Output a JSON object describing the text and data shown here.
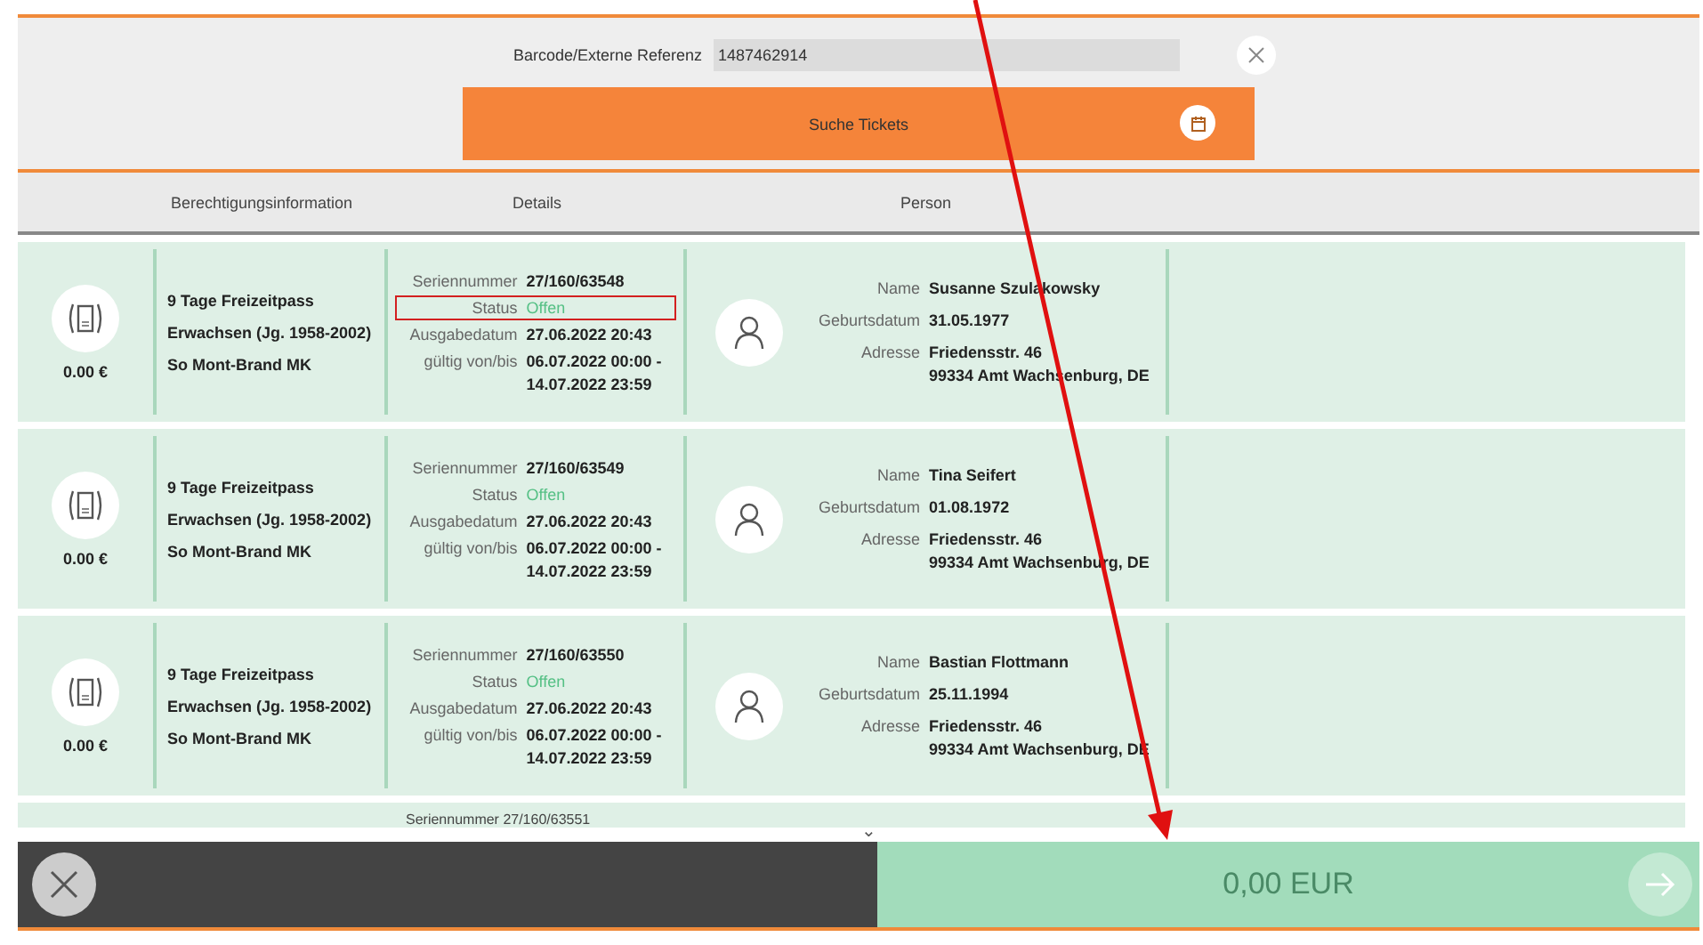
{
  "search": {
    "label": "Barcode/Externe Referenz",
    "value": "1487462914",
    "button": "Suche Tickets"
  },
  "columns": [
    "Berechtigungsinformation",
    "Details",
    "Person"
  ],
  "tickets": [
    {
      "price": "0.00 €",
      "product": "9 Tage Freizeitpass",
      "category": "Erwachsen (Jg. 1958-2002)",
      "area": "So Mont-Brand MK",
      "serial_label": "Seriennummer",
      "serial": "27/160/63548",
      "status_label": "Status",
      "status": "Offen",
      "status_marked": true,
      "issued_label": "Ausgabedatum",
      "issued": "27.06.2022 20:43",
      "valid_label": "gültig von/bis",
      "valid_from": "06.07.2022 00:00 -",
      "valid_to": "14.07.2022 23:59",
      "name_label": "Name",
      "name": "Susanne Szulakowsky",
      "birth_label": "Geburtsdatum",
      "birth": "31.05.1977",
      "address_label": "Adresse",
      "address": [
        "Friedensstr. 46",
        "99334 Amt Wachsenburg, DE"
      ]
    },
    {
      "price": "0.00 €",
      "product": "9 Tage Freizeitpass",
      "category": "Erwachsen (Jg. 1958-2002)",
      "area": "So Mont-Brand MK",
      "serial_label": "Seriennummer",
      "serial": "27/160/63549",
      "status_label": "Status",
      "status": "Offen",
      "status_marked": false,
      "issued_label": "Ausgabedatum",
      "issued": "27.06.2022 20:43",
      "valid_label": "gültig von/bis",
      "valid_from": "06.07.2022 00:00 -",
      "valid_to": "14.07.2022 23:59",
      "name_label": "Name",
      "name": "Tina  Seifert",
      "birth_label": "Geburtsdatum",
      "birth": "01.08.1972",
      "address_label": "Adresse",
      "address": [
        "Friedensstr. 46",
        "99334 Amt Wachsenburg, DE"
      ]
    },
    {
      "price": "0.00 €",
      "product": "9 Tage Freizeitpass",
      "category": "Erwachsen (Jg. 1958-2002)",
      "area": "So Mont-Brand MK",
      "serial_label": "Seriennummer",
      "serial": "27/160/63550",
      "status_label": "Status",
      "status": "Offen",
      "status_marked": false,
      "issued_label": "Ausgabedatum",
      "issued": "27.06.2022 20:43",
      "valid_label": "gültig von/bis",
      "valid_from": "06.07.2022 00:00 -",
      "valid_to": "14.07.2022 23:59",
      "name_label": "Name",
      "name": "Bastian  Flottmann",
      "birth_label": "Geburtsdatum",
      "birth": "25.11.1994",
      "address_label": "Adresse",
      "address": [
        "Friedensstr. 46",
        "99334 Amt Wachsenburg, DE"
      ]
    }
  ],
  "partial_ticket": {
    "serial_label": "Seriennummer",
    "serial": "27/160/63551"
  },
  "scroll_hint": "⌄",
  "total": "0,00 EUR",
  "annotation_arrow": true
}
